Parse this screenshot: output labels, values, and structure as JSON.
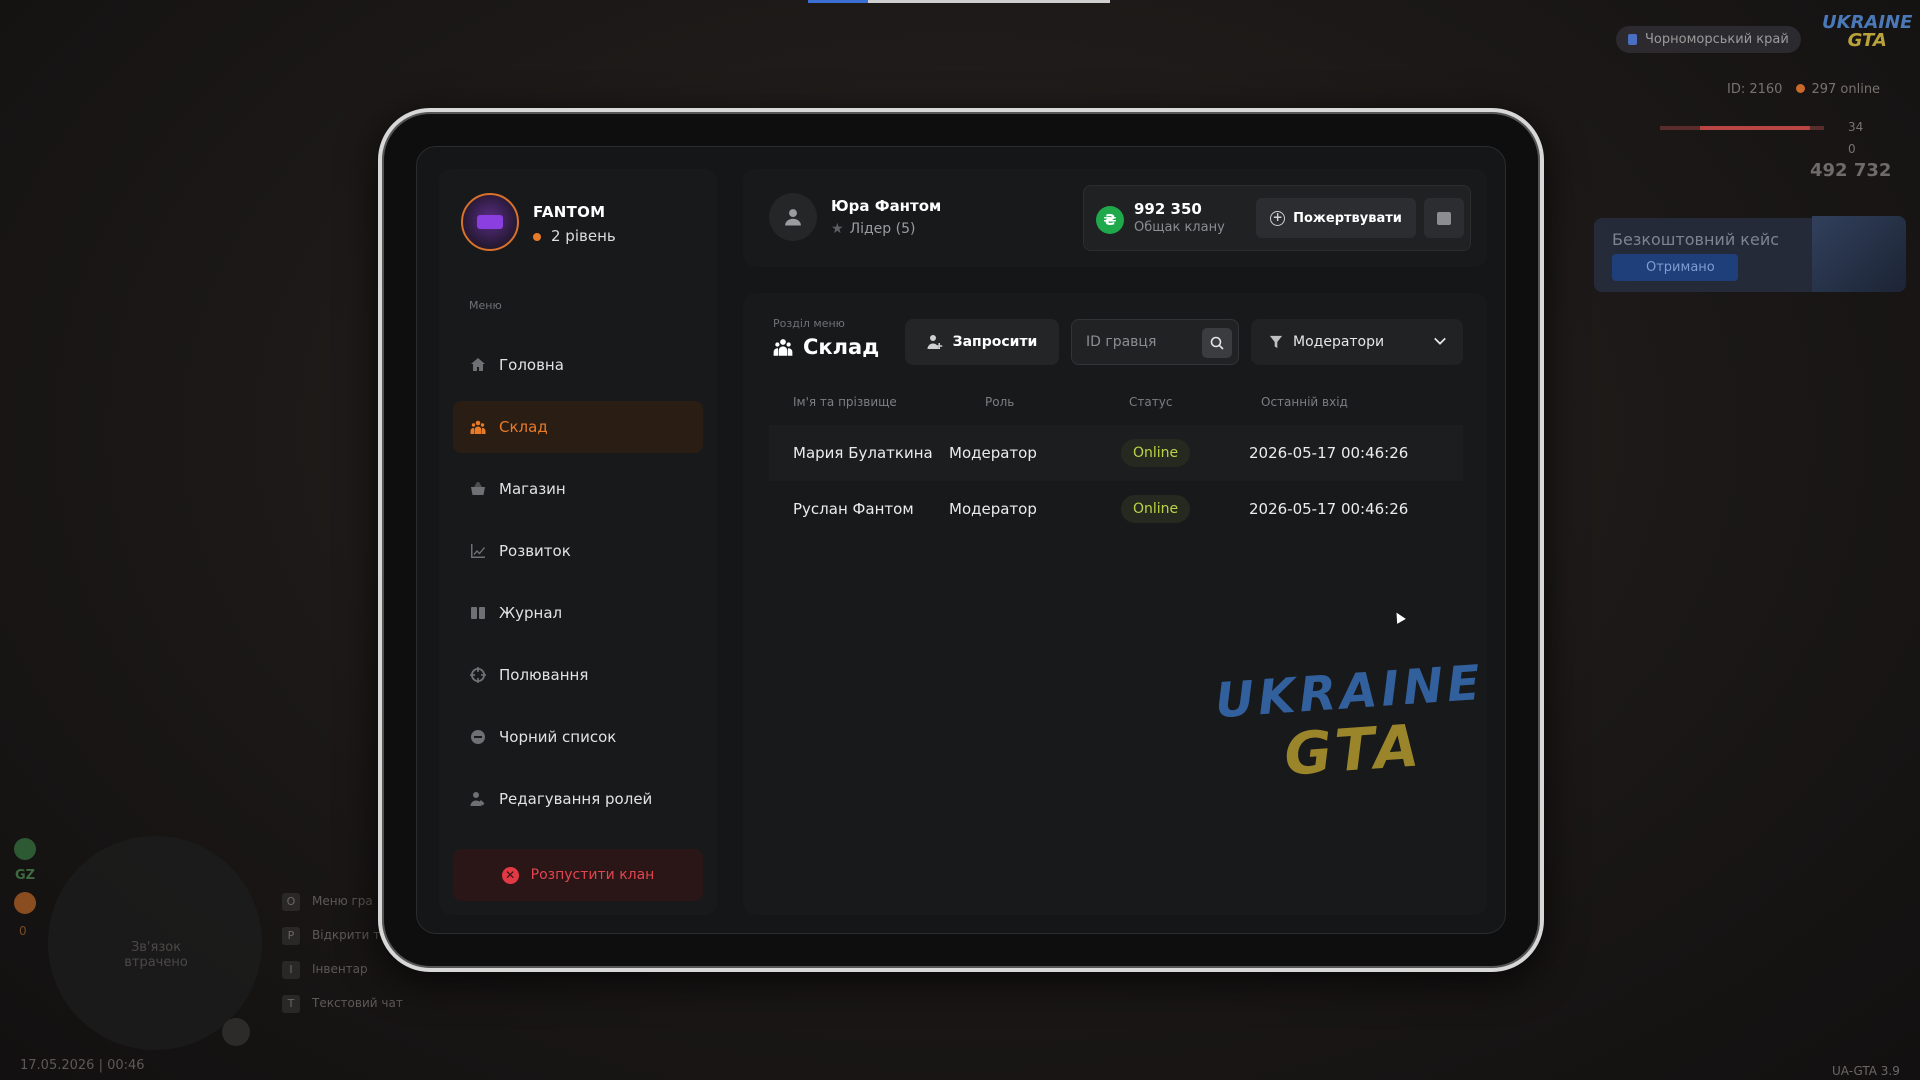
{
  "hud": {
    "region": "Чорноморський край",
    "logo_top": "UKRAINE",
    "logo_bottom": "GTA",
    "player_id": "ID: 2160",
    "online": "297 online",
    "health": "34",
    "armor": "0",
    "money": "492 732",
    "free_case_title": "Безкоштовний кейс",
    "free_case_button": "Отримано",
    "minimap_text": "Зв'язок втрачено",
    "gz_label": "GZ",
    "gz_value": "0",
    "keys": [
      {
        "key": "O",
        "label": "Меню гра"
      },
      {
        "key": "P",
        "label": "Відкрити т"
      },
      {
        "key": "I",
        "label": "Інвентар"
      },
      {
        "key": "T",
        "label": "Текстовий чат"
      }
    ],
    "datetime": "17.05.2026 | 00:46",
    "version": "UA-GTA 3.9"
  },
  "profile": {
    "name": "FANTOM",
    "level": "2 рівень"
  },
  "menu": {
    "heading": "Меню",
    "items": [
      {
        "label": "Головна",
        "icon": "home-icon",
        "active": false
      },
      {
        "label": "Склад",
        "icon": "users-icon",
        "active": true
      },
      {
        "label": "Магазин",
        "icon": "basket-icon",
        "active": false
      },
      {
        "label": "Розвиток",
        "icon": "chart-icon",
        "active": false
      },
      {
        "label": "Журнал",
        "icon": "book-icon",
        "active": false
      },
      {
        "label": "Полювання",
        "icon": "crosshair-icon",
        "active": false
      },
      {
        "label": "Чорний список",
        "icon": "block-icon",
        "active": false
      },
      {
        "label": "Редагування ролей",
        "icon": "user-edit-icon",
        "active": false
      }
    ],
    "disband_label": "Розпустити клан"
  },
  "leader": {
    "name": "Юра Фантом",
    "role": "Лідер (5)"
  },
  "fund": {
    "amount": "992 350",
    "label": "Общак клану",
    "donate_label": "Пожертвувати",
    "coin_symbol": "₴"
  },
  "section": {
    "hint": "Розділ меню",
    "title": "Склад",
    "invite_label": "Запросити",
    "search_placeholder": "ID гравця",
    "filter_value": "Модератори"
  },
  "table": {
    "headers": [
      "Ім'я та прізвище",
      "Роль",
      "Статус",
      "Останній вхід"
    ],
    "rows": [
      {
        "name": "Мария Булаткина",
        "role": "Модератор",
        "status": "Online",
        "last_login": "2026-05-17 00:46:26"
      },
      {
        "name": "Руслан Фантом",
        "role": "Модератор",
        "status": "Online",
        "last_login": "2026-05-17 00:46:26"
      }
    ]
  },
  "watermark": {
    "line1": "UKRAINE",
    "line2": "GTA"
  },
  "colors": {
    "accent": "#e87b28",
    "online": "#b9d34a",
    "danger": "#e23a44",
    "coin": "#1fa94a"
  }
}
